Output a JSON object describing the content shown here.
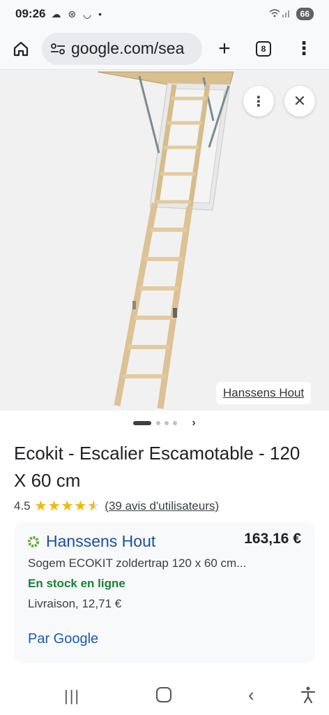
{
  "status_bar": {
    "time": "09:26",
    "notification_icons": "☁ ⊛ ◡ •",
    "battery": "66"
  },
  "browser": {
    "url": "google.com/sea",
    "tab_count": "8"
  },
  "image_viewer": {
    "source": "Hanssens Hout",
    "image_subject": "attic-folding-ladder"
  },
  "product": {
    "title": "Ecokit - Escalier Escamotable - 120 X 60 cm",
    "rating": "4.5",
    "stars": "★★★★★",
    "rating_value": 4.5,
    "reviews": "(39 avis d'utilisateurs)"
  },
  "offer": {
    "seller": "Hanssens Hout",
    "price": "163,16 €",
    "description": "Sogem ECOKIT zoldertrap 120 x 60 cm...",
    "stock": "En stock en ligne",
    "shipping": "Livraison, 12,71 €",
    "by_google": "Par Google"
  },
  "colors": {
    "link_blue": "#1a4fa0",
    "stock_green": "#188038",
    "star_yellow": "#f8b600"
  }
}
